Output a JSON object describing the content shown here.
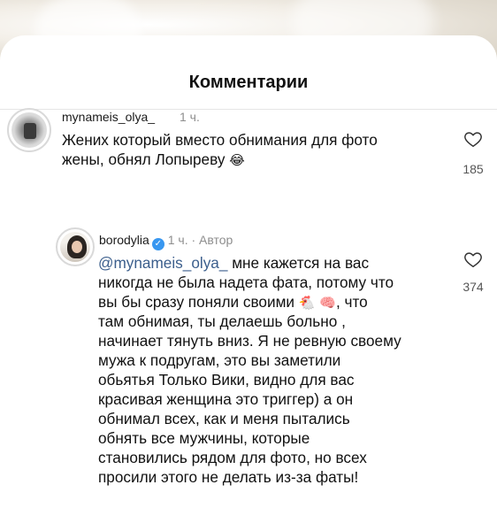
{
  "sheet": {
    "title": "Комментарии"
  },
  "comments": [
    {
      "username": "mynameis_olya_",
      "time": "1 ч.",
      "lines": [
        "Жених который вместо обнимания для фото",
        "жены, обнял Лопыреву"
      ],
      "emoji": "😂",
      "likes": "185"
    },
    {
      "username": "borodylia",
      "time": "1 ч.",
      "author_label": "Автор",
      "mention": "@mynameis_olya_",
      "line1_rest": " мне кажется на вас",
      "lines": [
        "никогда не была надета фата, потому что",
        "вы бы сразу поняли своими",
        "там обнимая, ты делаешь больно ,",
        "начинает тянуть вниз. Я не ревную своему",
        "мужа к подругам, это вы заметили",
        "обьятья Только Вики, видно для вас",
        "красивая женщина это триггер) а он",
        "обнимал всех, как и меня пытались",
        "обнять все мужчины, которые",
        "становились рядом для фото, но всех",
        "просили этого не делать из-за фаты!"
      ],
      "emoji_chicken": "🐔",
      "emoji_brain": "🧠",
      "line3_rest": ", что",
      "likes": "374"
    }
  ],
  "icons": {
    "heart": "heart-outline",
    "verified": "verified-badge"
  },
  "colors": {
    "mention": "#3b5e8c",
    "verified": "#3897f0",
    "meta": "#8e8e8e"
  }
}
